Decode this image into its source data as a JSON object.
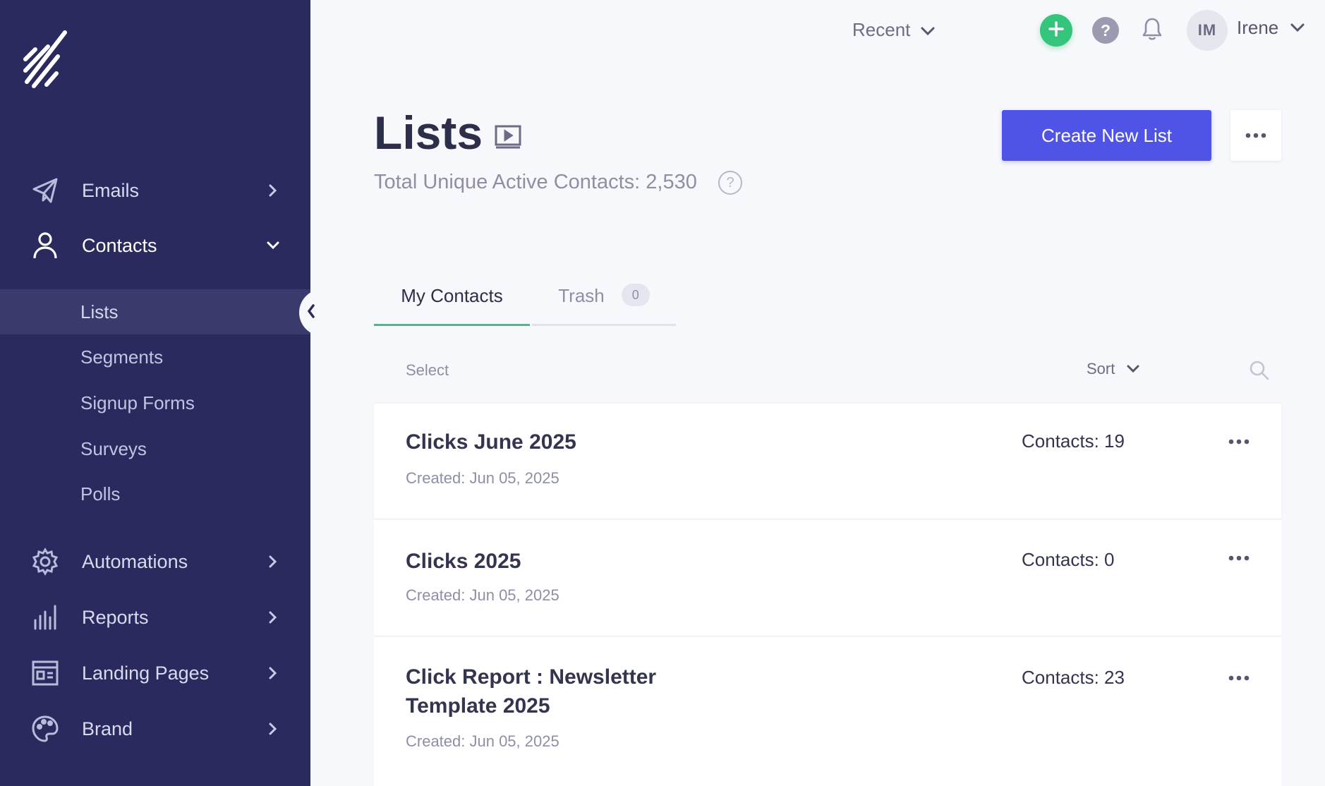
{
  "sidebar": {
    "nav": [
      {
        "label": "Emails",
        "icon": "send-icon",
        "expanded": false
      },
      {
        "label": "Contacts",
        "icon": "user-icon",
        "expanded": true
      },
      {
        "label": "Automations",
        "icon": "gear-icon",
        "expanded": false
      },
      {
        "label": "Reports",
        "icon": "bar-chart-icon",
        "expanded": false
      },
      {
        "label": "Landing Pages",
        "icon": "landing-page-icon",
        "expanded": false
      },
      {
        "label": "Brand",
        "icon": "palette-icon",
        "expanded": false
      }
    ],
    "contacts_submenu": [
      {
        "label": "Lists",
        "active": true
      },
      {
        "label": "Segments",
        "active": false
      },
      {
        "label": "Signup Forms",
        "active": false
      },
      {
        "label": "Surveys",
        "active": false
      },
      {
        "label": "Polls",
        "active": false
      }
    ]
  },
  "topbar": {
    "recent_label": "Recent",
    "user_initials": "IM",
    "user_name": "Irene",
    "help_glyph": "?"
  },
  "page": {
    "title": "Lists",
    "subtitle": "Total Unique Active Contacts: 2,530",
    "create_button": "Create New List"
  },
  "tabs": [
    {
      "label": "My Contacts",
      "active": true
    },
    {
      "label": "Trash",
      "active": false,
      "badge": "0"
    }
  ],
  "toolbar": {
    "select_label": "Select",
    "sort_label": "Sort"
  },
  "lists": [
    {
      "name": "Clicks June 2025",
      "created": "Created: Jun 05, 2025",
      "contacts": "Contacts: 19"
    },
    {
      "name": "Clicks 2025",
      "created": "Created: Jun 05, 2025",
      "contacts": "Contacts: 0"
    },
    {
      "name": "Click Report : Newsletter Template 2025",
      "created": "Created: Jun 05, 2025",
      "contacts": "Contacts: 23"
    }
  ],
  "colors": {
    "sidebar_bg": "#2b2a5e",
    "primary_button": "#4f54e6",
    "active_tab_underline": "#3bc28a",
    "plus_button": "#34c47c"
  }
}
